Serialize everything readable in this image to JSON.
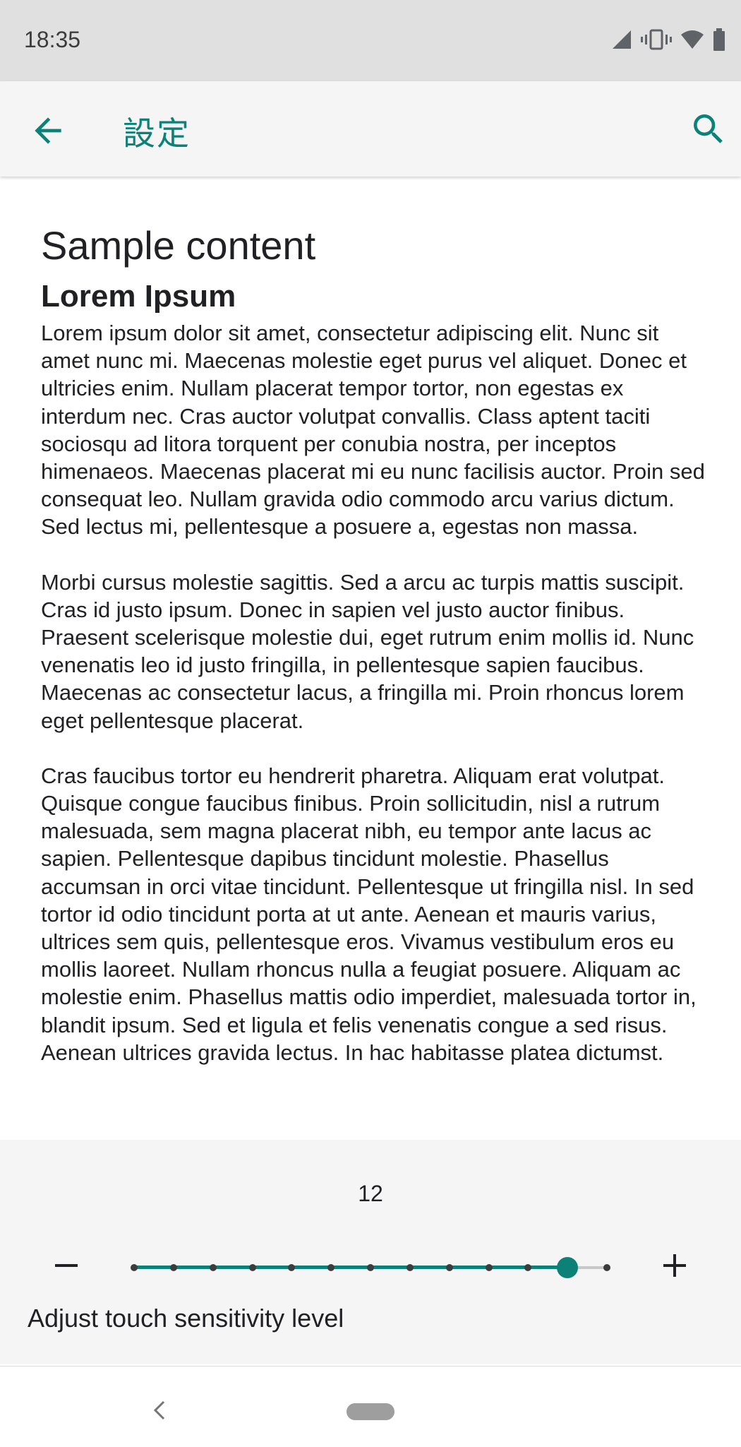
{
  "status_bar": {
    "time": "18:35",
    "icons": [
      "cell-signal-icon",
      "vibrate-icon",
      "wifi-icon",
      "battery-icon"
    ]
  },
  "app_bar": {
    "title": "設定",
    "back_icon": "arrow-back-icon",
    "search_icon": "search-icon",
    "accent_color": "#0b8177"
  },
  "content": {
    "title": "Sample content",
    "heading": "Lorem Ipsum",
    "paragraphs": [
      "Lorem ipsum dolor sit amet, consectetur adipiscing elit. Nunc sit amet nunc mi. Maecenas molestie eget purus vel aliquet. Donec et ultricies enim. Nullam placerat tempor tortor, non egestas ex interdum nec. Cras auctor volutpat convallis. Class aptent taciti sociosqu ad litora torquent per conubia nostra, per inceptos himenaeos. Maecenas placerat mi eu nunc facilisis auctor. Proin sed consequat leo. Nullam gravida odio commodo arcu varius dictum. Sed lectus mi, pellentesque a posuere a, egestas non massa.",
      "Morbi cursus molestie sagittis. Sed a arcu ac turpis mattis suscipit. Cras id justo ipsum. Donec in sapien vel justo auctor finibus. Praesent scelerisque molestie dui, eget rutrum enim mollis id. Nunc venenatis leo id justo fringilla, in pellentesque sapien faucibus. Maecenas ac consectetur lacus, a fringilla mi. Proin rhoncus lorem eget pellentesque placerat.",
      "Cras faucibus tortor eu hendrerit pharetra. Aliquam erat volutpat. Quisque congue faucibus finibus. Proin sollicitudin, nisl a rutrum malesuada, sem magna placerat nibh, eu tempor ante lacus ac sapien. Pellentesque dapibus tincidunt molestie. Phasellus accumsan in orci vitae tincidunt. Pellentesque ut fringilla nisl. In sed tortor id odio tincidunt porta at ut ante. Aenean et mauris varius, ultrices sem quis, pellentesque eros. Vivamus vestibulum eros eu mollis laoreet. Nullam rhoncus nulla a feugiat posuere. Aliquam ac molestie enim. Phasellus mattis odio imperdiet, malesuada tortor in, blandit ipsum. Sed et ligula et felis venenatis congue a sed risus. Aenean ultrices gravida lectus. In hac habitasse platea dictumst."
    ]
  },
  "sensitivity": {
    "value_label": "12",
    "value": 12,
    "min": 1,
    "max": 13,
    "label": "Adjust touch sensitivity level",
    "minus_icon": "minus-icon",
    "plus_icon": "plus-icon"
  },
  "nav_bar": {
    "back_icon": "nav-back-icon",
    "home_icon": "home-pill-icon"
  }
}
